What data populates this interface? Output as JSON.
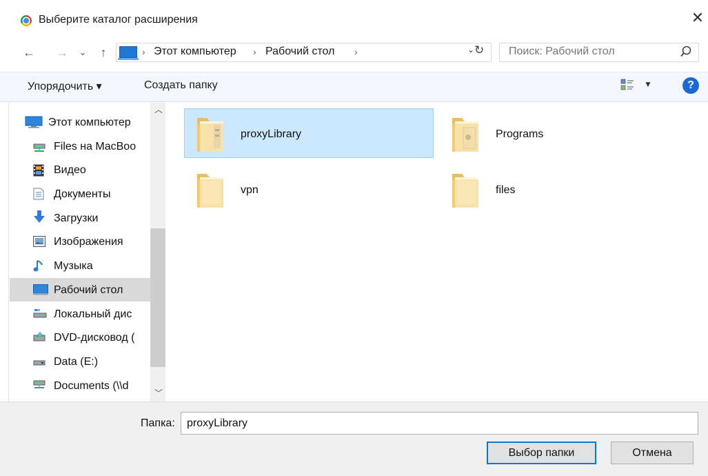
{
  "window": {
    "title": "Выберите каталог расширения"
  },
  "nav_buttons": {
    "back": "←",
    "forward": "→",
    "recent": "⌄",
    "up": "↑"
  },
  "address": {
    "crumbs": [
      "Этот компьютер",
      "Рабочий стол"
    ],
    "separator": "›"
  },
  "search": {
    "placeholder": "Поиск: Рабочий стол"
  },
  "toolbar": {
    "organize": "Упорядочить ▾",
    "new_folder": "Создать папку"
  },
  "sidebar": {
    "items": [
      {
        "label": "Этот компьютер",
        "icon": "computer-icon"
      },
      {
        "label": "Files на MacBoo",
        "icon": "network-drive-icon"
      },
      {
        "label": "Видео",
        "icon": "video-icon"
      },
      {
        "label": "Документы",
        "icon": "documents-icon"
      },
      {
        "label": "Загрузки",
        "icon": "downloads-icon"
      },
      {
        "label": "Изображения",
        "icon": "pictures-icon"
      },
      {
        "label": "Музыка",
        "icon": "music-icon"
      },
      {
        "label": "Рабочий стол",
        "icon": "desktop-icon",
        "selected": true
      },
      {
        "label": "Локальный дис",
        "icon": "local-disk-icon"
      },
      {
        "label": "DVD-дисковод (",
        "icon": "dvd-drive-icon"
      },
      {
        "label": "Data (E:)",
        "icon": "drive-icon"
      },
      {
        "label": "Documents (\\\\d",
        "icon": "network-drive-icon"
      }
    ]
  },
  "folders": [
    {
      "name": "proxyLibrary",
      "selected": true
    },
    {
      "name": "Programs"
    },
    {
      "name": "vpn"
    },
    {
      "name": "files"
    }
  ],
  "footer": {
    "folder_label": "Папка:",
    "folder_value": "proxyLibrary",
    "select_button": "Выбор папки",
    "cancel_button": "Отмена"
  },
  "colors": {
    "accent": "#0078d7",
    "selection": "#cce8ff",
    "help": "#1a6bd1"
  }
}
